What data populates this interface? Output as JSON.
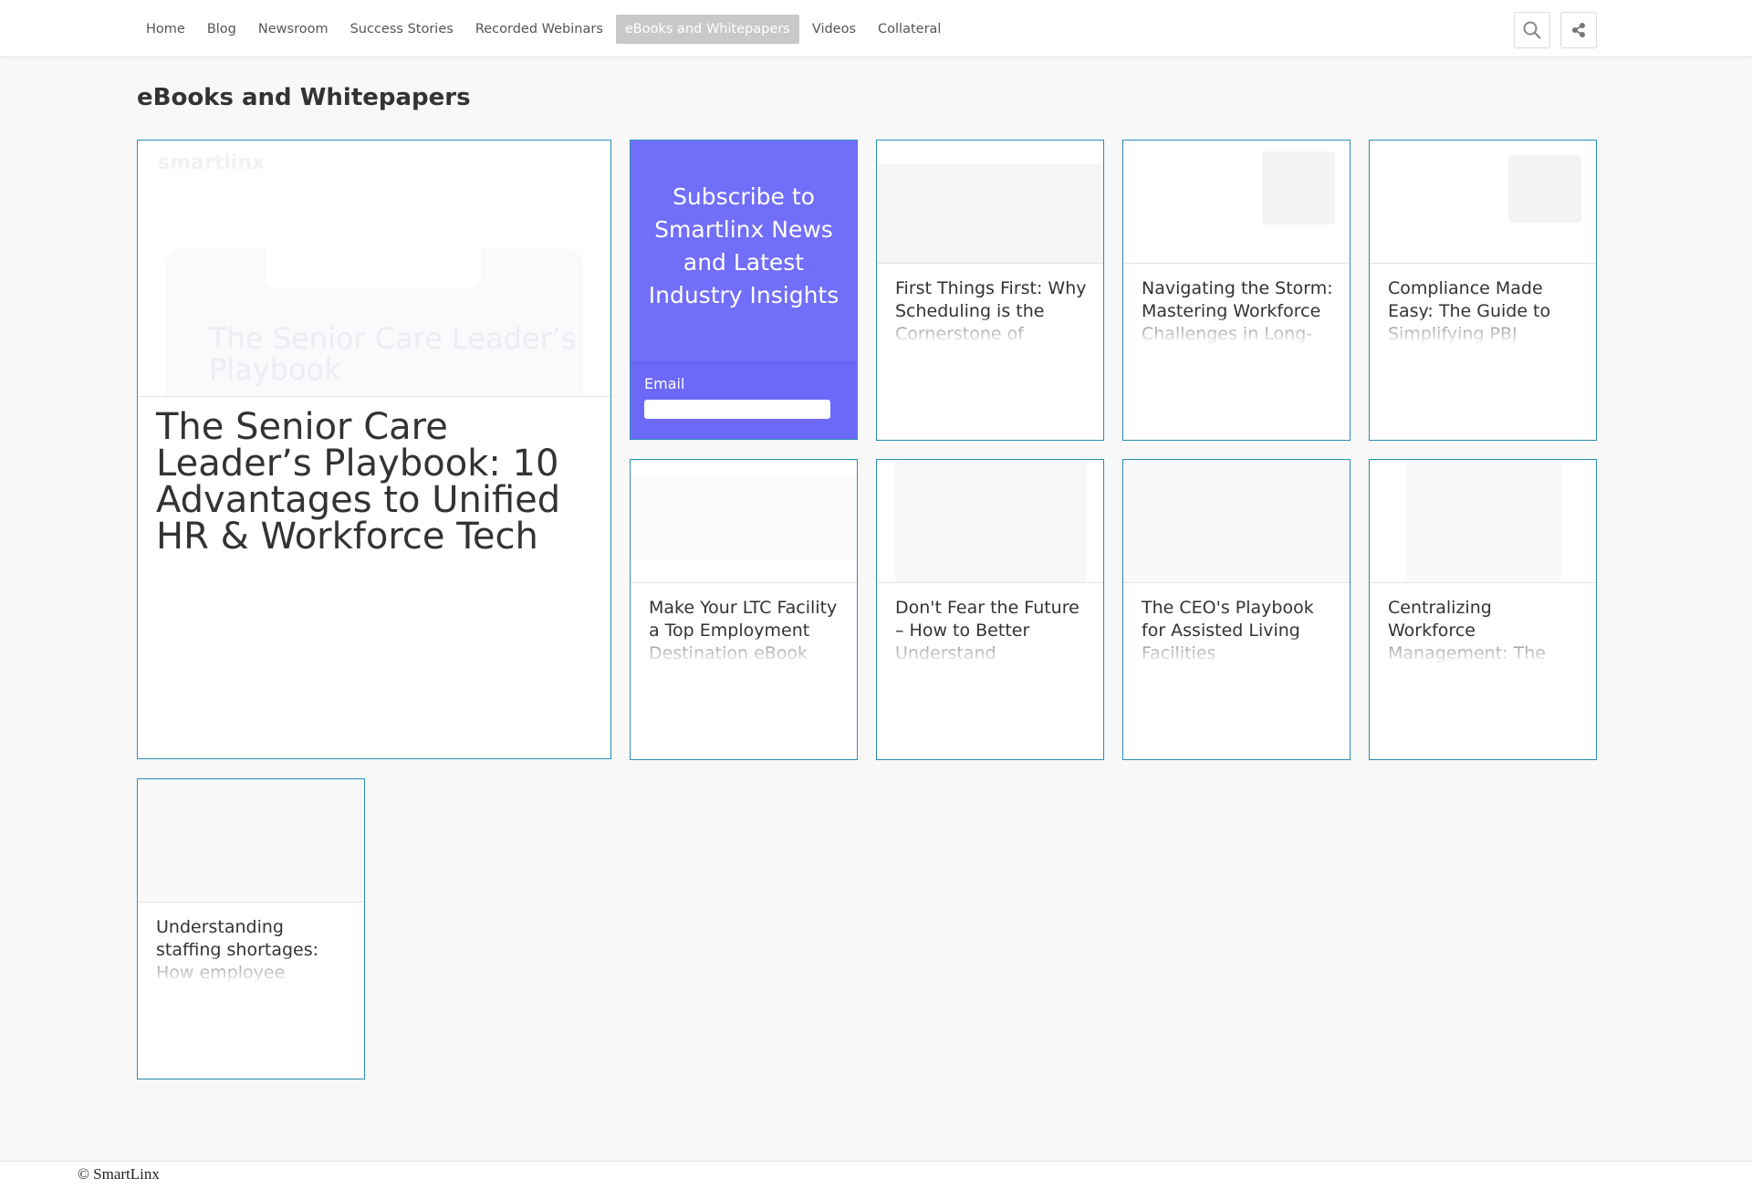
{
  "header": {
    "nav": [
      "Home",
      "Blog",
      "Newsroom",
      "Success Stories",
      "Recorded Webinars",
      "eBooks and Whitepapers",
      "Videos",
      "Collateral"
    ],
    "active_nav": "eBooks and Whitepapers",
    "search_icon": "search-icon",
    "share_icon": "share-icon"
  },
  "page": {
    "title": "eBooks and Whitepapers"
  },
  "featured": {
    "title": "The Senior Care Leader’s Playbook: 10 Advantages to Unified HR & Workforce Tech",
    "thumb_logo": "smartlinx",
    "thumb_text": "The Senior Care Leader’s Playbook"
  },
  "subscribe": {
    "title": "Subscribe to Smartlinx News and Latest Industry Insights",
    "email_label": "Email",
    "accent": "#716ef9"
  },
  "cards": [
    {
      "title": "First Things First: Why Scheduling is the Cornerstone of"
    },
    {
      "title": "Navigating the Storm: Mastering Workforce Challenges in Long-"
    },
    {
      "title": "Compliance Made Easy: The Guide to Simplifying PBJ"
    },
    {
      "title": "Make Your LTC Facility a Top Employment Destination eBook"
    },
    {
      "title": "Don't Fear the Future – How to Better Understand"
    },
    {
      "title": "The CEO's Playbook for Assisted Living Facilities"
    },
    {
      "title": "Centralizing Workforce Management: The"
    },
    {
      "title": "Understanding staffing shortages: How employee"
    }
  ],
  "footer": {
    "copyright": "© SmartLinx"
  },
  "colors": {
    "card_border": "#2a8fb4",
    "background": "#f8f8f8"
  }
}
